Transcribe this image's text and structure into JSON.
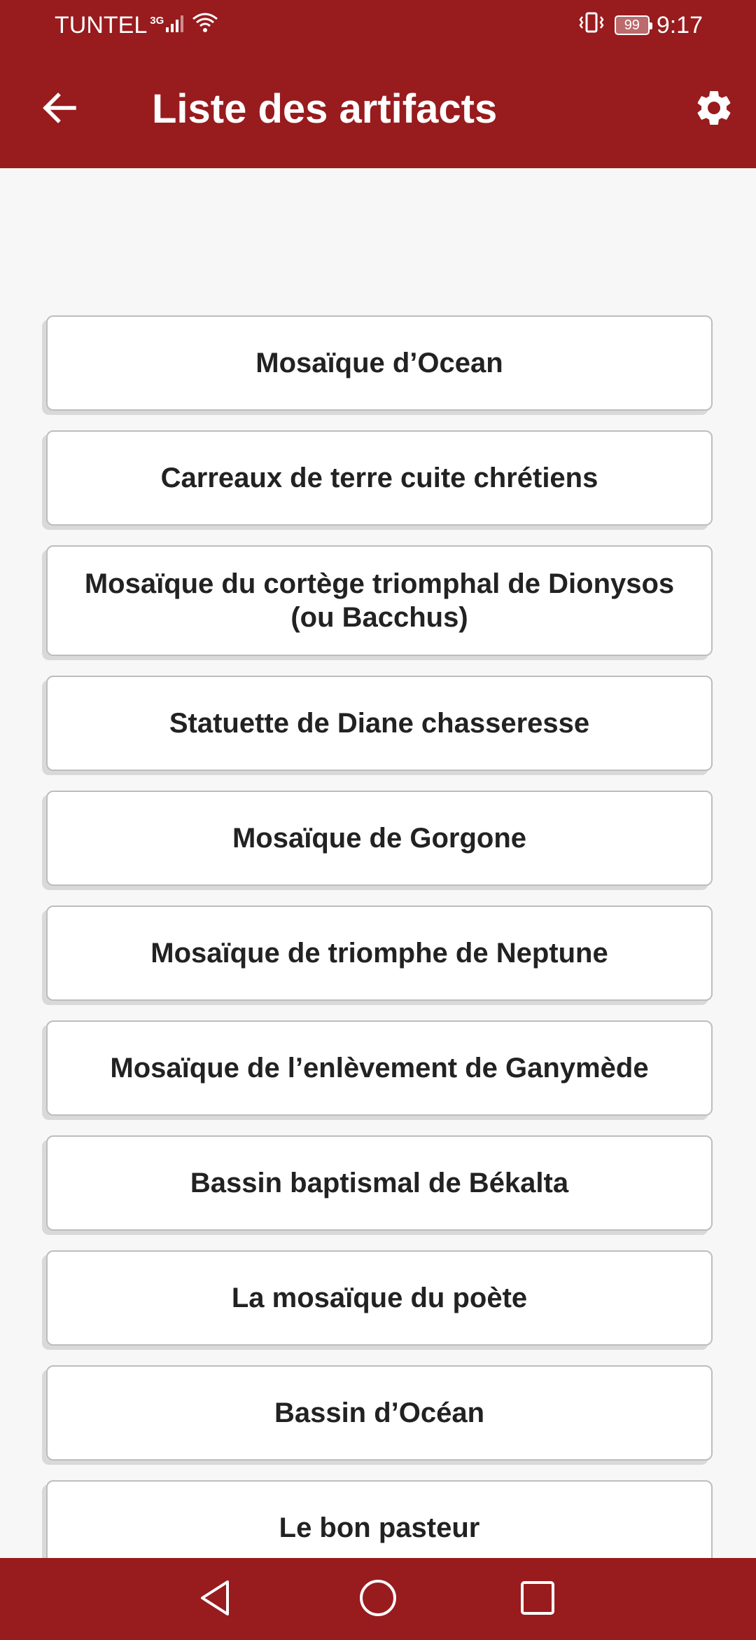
{
  "status_bar": {
    "carrier": "TUNTEL",
    "network": "3G",
    "battery": "99",
    "time": "9:17"
  },
  "app_bar": {
    "title": "Liste des artifacts",
    "back_icon": "arrow-back-icon",
    "settings_icon": "gear-icon"
  },
  "artifacts": [
    {
      "label": "Mosaïque d’Ocean"
    },
    {
      "label": "Carreaux de terre cuite chrétiens"
    },
    {
      "label": "Mosaïque du cortège triomphal de Dionysos (ou Bacchus)"
    },
    {
      "label": "Statuette de Diane chasseresse"
    },
    {
      "label": "Mosaïque de Gorgone"
    },
    {
      "label": "Mosaïque de triomphe de Neptune"
    },
    {
      "label": "Mosaïque de l’enlèvement de Ganymède"
    },
    {
      "label": "Bassin baptismal de Békalta"
    },
    {
      "label": "La mosaïque du poète"
    },
    {
      "label": "Bassin d’Océan"
    },
    {
      "label": "Le bon pasteur"
    }
  ],
  "nav_bar": {
    "back_icon": "triangle-back-icon",
    "home_icon": "circle-home-icon",
    "recents_icon": "square-recents-icon"
  },
  "colors": {
    "primary": "#981b1e",
    "background": "#f7f7f7",
    "card": "#ffffff",
    "text": "#222222"
  }
}
